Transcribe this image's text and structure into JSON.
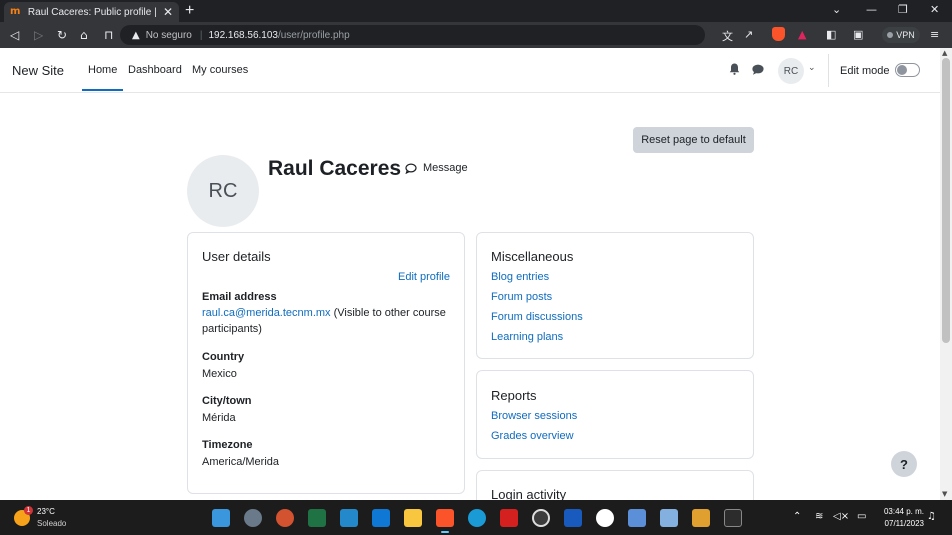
{
  "browser": {
    "tab_title": "Raul Caceres: Public profile | New Site",
    "tab_favicon": "moodle-icon",
    "not_secure": "No seguro",
    "url_host": "192.168.56.103",
    "url_path": "/user/profile.php",
    "vpn_label": "VPN"
  },
  "navbar": {
    "site_name": "New Site",
    "links": [
      {
        "label": "Home",
        "active": true
      },
      {
        "label": "Dashboard",
        "active": false
      },
      {
        "label": "My courses",
        "active": false
      }
    ],
    "user_initials": "RC",
    "edit_mode_label": "Edit mode",
    "edit_mode_on": false
  },
  "page": {
    "reset_button": "Reset page to default",
    "avatar_initials": "RC",
    "fullname": "Raul Caceres",
    "message_label": "Message",
    "help_label": "?"
  },
  "user_details": {
    "title": "User details",
    "edit_profile": "Edit profile",
    "email_label": "Email address",
    "email_value": "raul.ca@merida.tecnm.mx",
    "email_note_1": " (Visible to other course",
    "email_note_2": "participants)",
    "country_label": "Country",
    "country_value": "Mexico",
    "city_label": "City/town",
    "city_value": "Mérida",
    "timezone_label": "Timezone",
    "timezone_value": "America/Merida"
  },
  "miscellaneous": {
    "title": "Miscellaneous",
    "links": [
      "Blog entries",
      "Forum posts",
      "Forum discussions",
      "Learning plans"
    ]
  },
  "reports": {
    "title": "Reports",
    "links": [
      "Browser sessions",
      "Grades overview"
    ]
  },
  "login_activity": {
    "title": "Login activity"
  },
  "taskbar": {
    "weather_temp": "23°C",
    "weather_desc": "Soleado",
    "weather_badge": "1",
    "clock_time": "03:44 p. m.",
    "clock_date": "07/11/2023"
  },
  "colors": {
    "link": "#0f6cbf",
    "tab_bar": "#202124",
    "taskbar": "#1c1c1c"
  }
}
